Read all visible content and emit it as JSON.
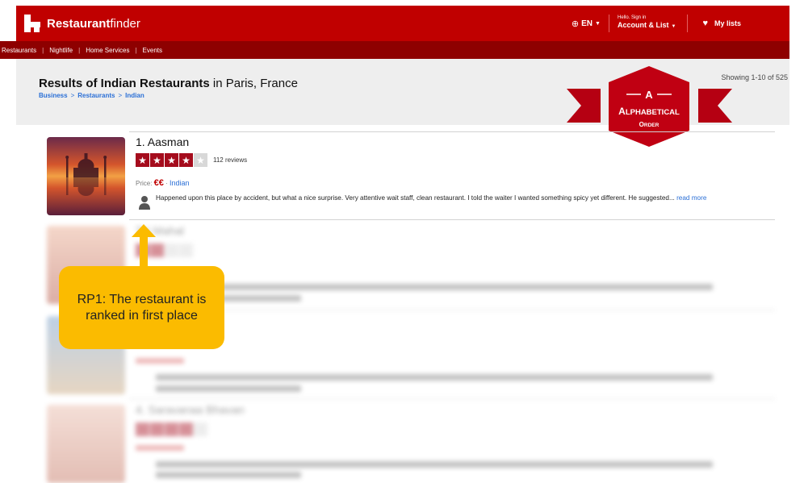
{
  "header": {
    "brand_bold": "Restaurant",
    "brand_light": "finder",
    "language": "EN",
    "hello": "Hello. Sign in",
    "account": "Account & List",
    "my_lists": "My lists"
  },
  "nav": {
    "items": [
      "Restaurants",
      "Nightlife",
      "Home Services",
      "Events"
    ]
  },
  "search": {
    "title_bold": "Results of Indian Restaurants",
    "title_rest": " in Paris, France",
    "breadcrumb": [
      "Business",
      "Restaurants",
      "Indian"
    ],
    "showing": "Showing 1-10 of 525"
  },
  "sort_badge": {
    "letter": "A",
    "label_cap": "A",
    "label_rest": "LPHABETICAL",
    "sub_cap": "O",
    "sub_rest": "RDER"
  },
  "restaurants": [
    {
      "name": "1. Aasman",
      "rating": 4,
      "reviews": "112 reviews",
      "price_label": "Price: ",
      "price": "€€",
      "dot": " · ",
      "cuisine": "Indian",
      "review_text": "Happened upon this place by accident, but what a nice surprise. Very attentive wait staff, clean restaurant. I told the waiter I wanted something spicy yet different. He suggested... ",
      "read_more": "read more"
    }
  ],
  "blurred_names": [
    "Taj Mahal",
    "",
    "4. Saravanaa Bhavan"
  ],
  "annotation": {
    "text": "RP1: The restaurant is ranked in first place",
    "color": "#fbbb00"
  },
  "colors": {
    "brand_red": "#c00000",
    "nav_dark": "#8e0000",
    "star_red": "#a50c1d",
    "link_blue": "#2a6fd6"
  }
}
